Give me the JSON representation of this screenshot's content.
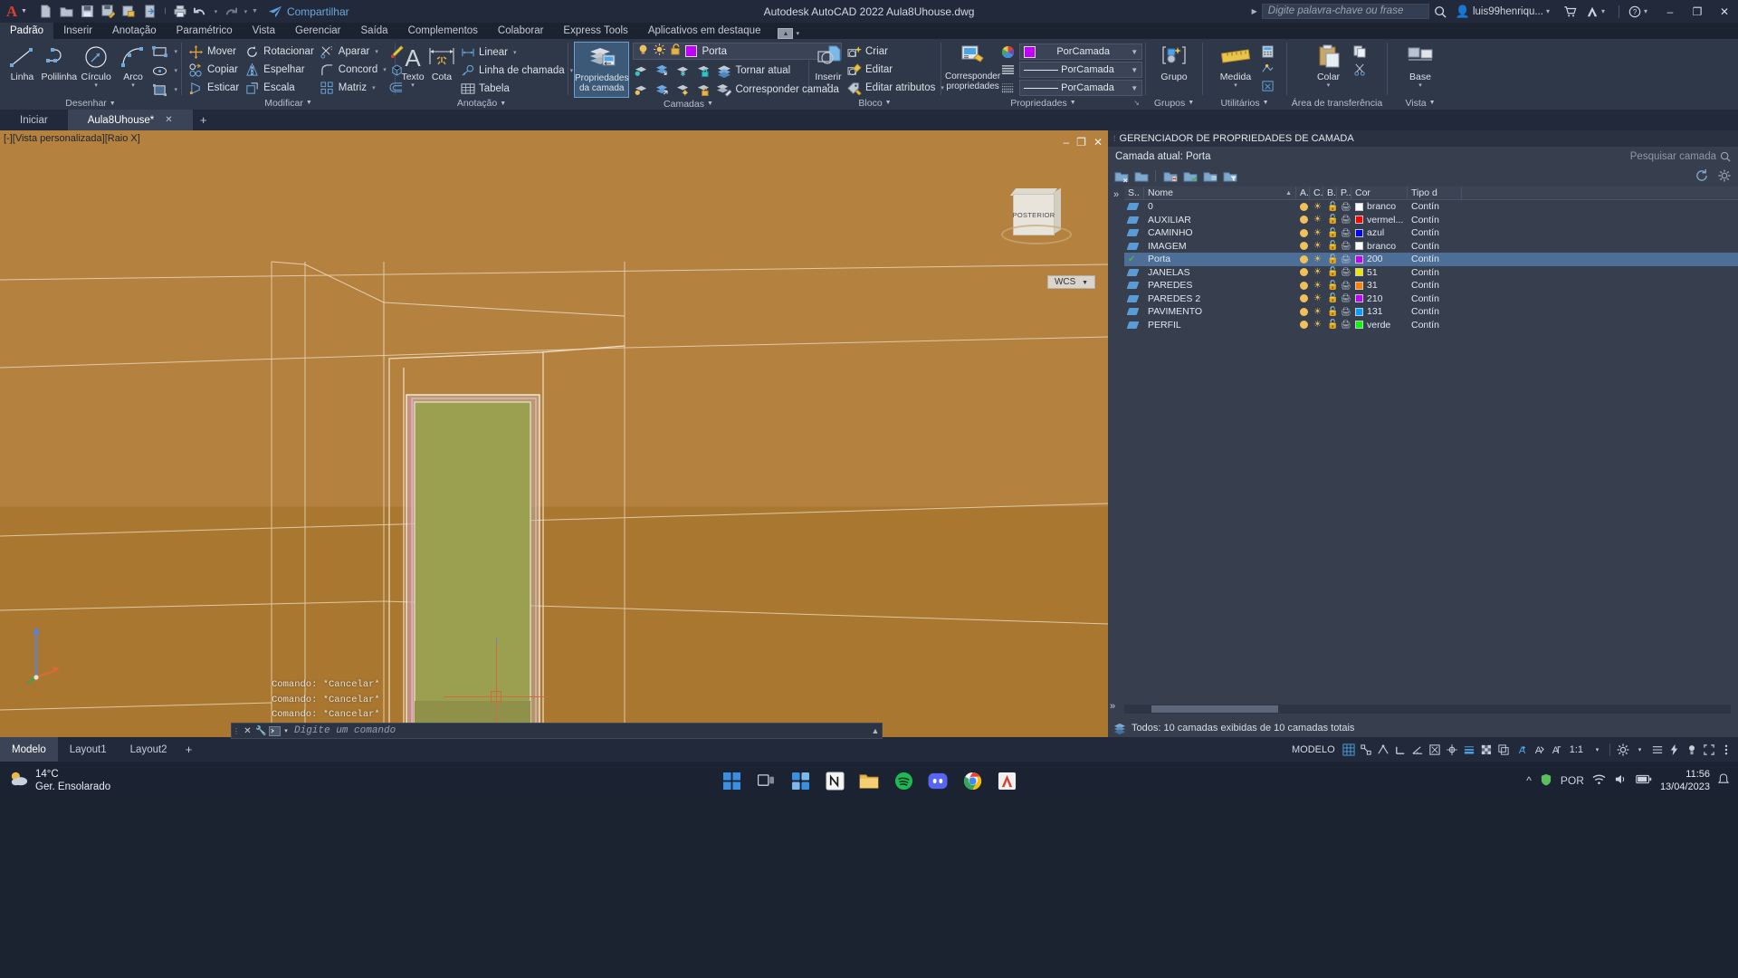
{
  "titlebar": {
    "app_title": "Autodesk AutoCAD 2022    Aula8Uhouse.dwg",
    "share_label": "Compartilhar",
    "search_placeholder": "Digite palavra-chave ou frase",
    "user_name": "luis99henriqu...",
    "qat": [
      {
        "name": "new-file-icon",
        "glyph": "🗋"
      },
      {
        "name": "open-file-icon",
        "glyph": "📂"
      },
      {
        "name": "save-icon",
        "glyph": "💾"
      },
      {
        "name": "save-as-icon",
        "glyph": "💾"
      },
      {
        "name": "plot-preview-icon",
        "glyph": "🖹"
      },
      {
        "name": "publish-icon",
        "glyph": "🗘"
      },
      {
        "name": "print-icon",
        "glyph": "🖨"
      },
      {
        "name": "undo-icon",
        "glyph": "←"
      },
      {
        "name": "redo-icon",
        "glyph": "→"
      }
    ],
    "window_buttons": {
      "minimize": "–",
      "restore": "❐",
      "close": "✕"
    }
  },
  "ribbon_tabs": [
    {
      "label": "Padrão",
      "active": true
    },
    {
      "label": "Inserir",
      "active": false
    },
    {
      "label": "Anotação",
      "active": false
    },
    {
      "label": "Paramétrico",
      "active": false
    },
    {
      "label": "Vista",
      "active": false
    },
    {
      "label": "Gerenciar",
      "active": false
    },
    {
      "label": "Saída",
      "active": false
    },
    {
      "label": "Complementos",
      "active": false
    },
    {
      "label": "Colaborar",
      "active": false
    },
    {
      "label": "Express Tools",
      "active": false
    },
    {
      "label": "Aplicativos em destaque",
      "active": false
    }
  ],
  "panels": {
    "desenhar": {
      "title": "Desenhar",
      "big": [
        {
          "label": "Linha",
          "icon": "line-icon"
        },
        {
          "label": "Polilinha",
          "icon": "polyline-icon"
        },
        {
          "label": "Círculo",
          "icon": "circle-icon",
          "has_caret": true
        },
        {
          "label": "Arco",
          "icon": "arc-icon",
          "has_caret": true
        }
      ],
      "small": [
        {
          "label": "",
          "icon": "rectangle-icon",
          "caret": true
        },
        {
          "label": "",
          "icon": "ellipse-icon",
          "caret": true
        },
        {
          "label": "",
          "icon": "hatch-icon",
          "caret": true
        }
      ]
    },
    "modificar": {
      "title": "Modificar",
      "col1": [
        {
          "label": "Mover",
          "icon": "move-icon"
        },
        {
          "label": "Copiar",
          "icon": "copy-icon"
        },
        {
          "label": "Esticar",
          "icon": "stretch-icon"
        }
      ],
      "col2": [
        {
          "label": "Rotacionar",
          "icon": "rotate-icon"
        },
        {
          "label": "Espelhar",
          "icon": "mirror-icon"
        },
        {
          "label": "Escala",
          "icon": "scale-icon"
        }
      ],
      "col3": [
        {
          "label": "Aparar",
          "icon": "trim-icon",
          "caret": true
        },
        {
          "label": "Concord",
          "icon": "fillet-icon",
          "caret": true
        },
        {
          "label": "Matriz",
          "icon": "array-icon",
          "caret": true
        }
      ],
      "col4": [
        {
          "label": "",
          "icon": "erase-brush-icon"
        },
        {
          "label": "",
          "icon": "explode-icon"
        },
        {
          "label": "",
          "icon": "offset-icon"
        }
      ]
    },
    "anotacao": {
      "title": "Anotação",
      "big": [
        {
          "label": "Texto",
          "icon": "text-icon",
          "has_caret": true
        },
        {
          "label": "Cota",
          "icon": "dimension-icon"
        }
      ],
      "small": [
        {
          "label": "Linear",
          "icon": "linear-dim-icon",
          "caret": true
        },
        {
          "label": "Linha de chamada",
          "icon": "leader-icon",
          "caret": true
        },
        {
          "label": "Tabela",
          "icon": "table-icon"
        }
      ]
    },
    "camadas": {
      "title": "Camadas",
      "big_label": "Propriedades\nda camada",
      "big_label_line1": "Propriedades",
      "big_label_line2": "da camada",
      "current_layer": "Porta",
      "current_layer_color": "#c000ff",
      "actions": [
        {
          "label": "Tornar atual",
          "icon": "make-current-icon"
        },
        {
          "label": "Corresponder camada",
          "icon": "match-layer-icon"
        }
      ],
      "row_icons_1": [
        "layer-isolate-icon",
        "layer-unisolate-icon",
        "layer-freeze-icon",
        "layer-lock-icon"
      ],
      "row_icons_2": [
        "layer-off-icon",
        "layer-turn-on-icon",
        "layer-thaw-icon",
        "layer-unlock-icon"
      ]
    },
    "bloco": {
      "title": "Bloco",
      "big_label": "Inserir",
      "items": [
        {
          "label": "Criar",
          "icon": "create-block-icon"
        },
        {
          "label": "Editar",
          "icon": "edit-block-icon"
        },
        {
          "label": "Editar atributos",
          "icon": "edit-attributes-icon",
          "caret": true
        }
      ]
    },
    "propriedades": {
      "title": "Propriedades",
      "big_label_line1": "Corresponder",
      "big_label_line2": "propriedades",
      "color_value": "PorCamada",
      "color_swatch": "#c000ff",
      "linetype_value": "PorCamada",
      "lineweight_value": "PorCamada"
    },
    "grupos": {
      "title": "Grupos",
      "big_label": "Grupo"
    },
    "utilitarios": {
      "title": "Utilitários",
      "big_label": "Medida"
    },
    "transferencia": {
      "title": "Área de transferência",
      "big_label": "Colar"
    },
    "vista": {
      "title": "Vista",
      "big_label": "Base"
    }
  },
  "file_tabs": [
    {
      "label": "Iniciar",
      "active": false,
      "closable": false
    },
    {
      "label": "Aula8Uhouse*",
      "active": true,
      "closable": true
    }
  ],
  "canvas": {
    "viewport_label": "[-][Vista personalizada][Raio X]",
    "navcube_face": "POSTERIOR",
    "wcs_label": "WCS",
    "command_history": [
      "Comando: *Cancelar*",
      "Comando: *Cancelar*",
      "Comando: *Cancelar*"
    ],
    "command_placeholder": "Digite um comando",
    "viewport_buttons": {
      "minimize": "–",
      "maximize": "❐",
      "close": "✕"
    }
  },
  "layer_manager": {
    "title": "GERENCIADOR DE PROPRIEDADES DE CAMADA",
    "current_label": "Camada atual: Porta",
    "search_placeholder": "Pesquisar camada",
    "columns": [
      "S..",
      "Nome",
      "A.",
      "C.",
      "B..",
      "P..",
      "Cor",
      "Tipo d"
    ],
    "rows": [
      {
        "status": "",
        "name": "0",
        "color": "branco",
        "color_hex": "#ffffff",
        "linetype": "Contín"
      },
      {
        "status": "",
        "name": "AUXILIAR",
        "color": "vermel...",
        "color_hex": "#ff0000",
        "linetype": "Contín"
      },
      {
        "status": "",
        "name": "CAMINHO",
        "color": "azul",
        "color_hex": "#0000ff",
        "linetype": "Contín"
      },
      {
        "status": "",
        "name": "IMAGEM",
        "color": "branco",
        "color_hex": "#ffffff",
        "linetype": "Contín"
      },
      {
        "status": "current",
        "name": "Porta",
        "color": "200",
        "color_hex": "#c000ff",
        "linetype": "Contín"
      },
      {
        "status": "",
        "name": "JANELAS",
        "color": "51",
        "color_hex": "#e8e800",
        "linetype": "Contín"
      },
      {
        "status": "",
        "name": "PAREDES",
        "color": "31",
        "color_hex": "#ff7f00",
        "linetype": "Contín"
      },
      {
        "status": "",
        "name": "PAREDES 2",
        "color": "210",
        "color_hex": "#bf00ff",
        "linetype": "Contín"
      },
      {
        "status": "",
        "name": "PAVIMENTO",
        "color": "131",
        "color_hex": "#00a0ff",
        "linetype": "Contín"
      },
      {
        "status": "",
        "name": "PERFIL",
        "color": "verde",
        "color_hex": "#00ff00",
        "linetype": "Contín"
      }
    ],
    "status_text": "Todos: 10 camadas exibidas de 10 camadas totais"
  },
  "statusbar": {
    "layout_tabs": [
      {
        "label": "Modelo",
        "active": true
      },
      {
        "label": "Layout1",
        "active": false
      },
      {
        "label": "Layout2",
        "active": false
      }
    ],
    "model_label": "MODELO",
    "scale": "1:1",
    "icons": [
      {
        "name": "grid-icon",
        "glyph": "▦",
        "on": true
      },
      {
        "name": "snap-icon",
        "glyph": "⬚",
        "on": false
      },
      {
        "name": "infer-constraints-icon",
        "glyph": "⫯",
        "on": false
      },
      {
        "name": "ortho-icon",
        "glyph": "⊥",
        "on": false
      },
      {
        "name": "polar-tracking-icon",
        "glyph": "∠",
        "on": false
      },
      {
        "name": "osnap-icon",
        "glyph": "◎",
        "on": false
      },
      {
        "name": "otrack-icon",
        "glyph": "⌖",
        "on": false
      },
      {
        "name": "lineweight-icon",
        "glyph": "≡",
        "on": true
      },
      {
        "name": "transparency-icon",
        "glyph": "▨",
        "on": false
      },
      {
        "name": "selection-cycling-icon",
        "glyph": "⧉",
        "on": false
      },
      {
        "name": "annotation-visibility-icon",
        "glyph": "🅐",
        "on": true
      },
      {
        "name": "autoscale-icon",
        "glyph": "🅐",
        "on": false
      },
      {
        "name": "annotation-scale-icon",
        "glyph": "🅐",
        "on": false
      },
      {
        "name": "workspace-icon",
        "glyph": "⚙",
        "on": false
      },
      {
        "name": "customization-icon",
        "glyph": "≡",
        "on": false
      },
      {
        "name": "hardware-accel-icon",
        "glyph": "⚡",
        "on": false
      },
      {
        "name": "isolate-objects-icon",
        "glyph": "💡",
        "on": false
      },
      {
        "name": "fullscreen-icon",
        "glyph": "⤡",
        "on": false
      }
    ]
  },
  "taskbar": {
    "weather_temp": "14°C",
    "weather_desc": "Ger. Ensolarado",
    "apps": [
      {
        "name": "start-button",
        "glyph": "⊞",
        "color": "#3b8fe0"
      },
      {
        "name": "task-view-button",
        "glyph": "▣",
        "color": "#c9d0da"
      },
      {
        "name": "widgets-button",
        "glyph": "▦",
        "color": "#3b8fe0"
      },
      {
        "name": "notion-app-icon",
        "glyph": "N",
        "color": "#f0f0f0"
      },
      {
        "name": "file-explorer-icon",
        "glyph": "📁",
        "color": "#e8b84a"
      },
      {
        "name": "spotify-icon",
        "glyph": "♫",
        "color": "#1db954"
      },
      {
        "name": "discord-icon",
        "glyph": "●",
        "color": "#5865f2"
      },
      {
        "name": "chrome-icon",
        "glyph": "◉",
        "color": "#4285f4"
      },
      {
        "name": "autocad-taskbar-icon",
        "glyph": "A",
        "color": "#d9402f"
      }
    ],
    "lang": "POR",
    "time": "11:56",
    "date": "13/04/2023"
  }
}
